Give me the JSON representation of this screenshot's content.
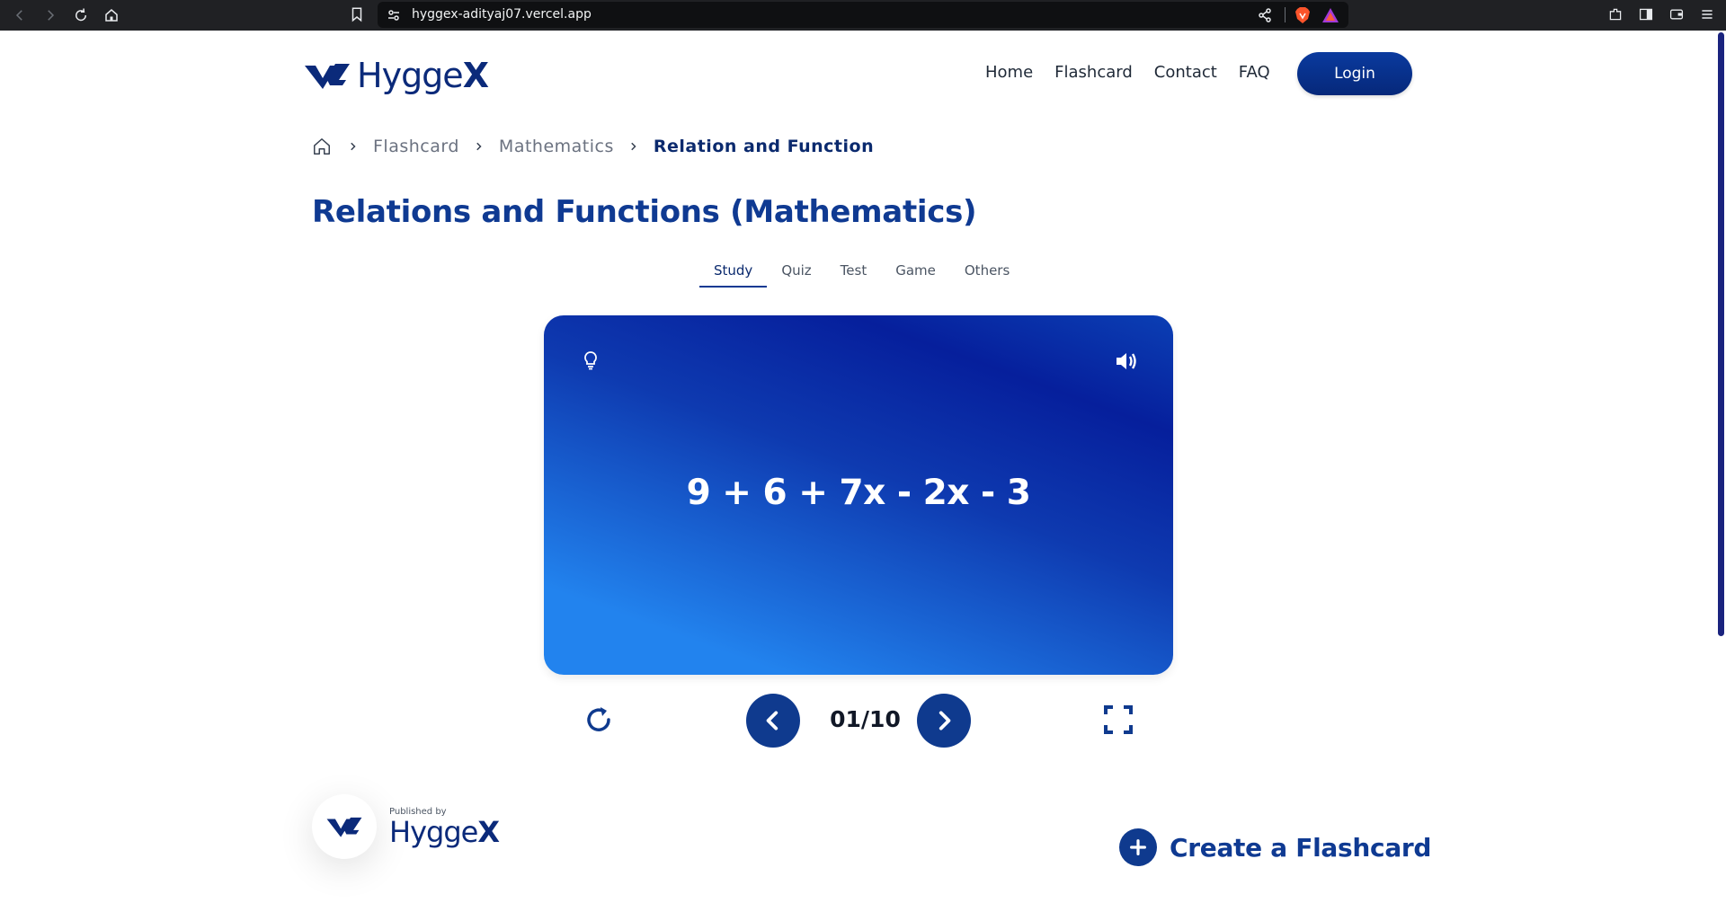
{
  "browser": {
    "url": "hyggex-adityaj07.vercel.app"
  },
  "header": {
    "logo_text_light": "Hygge",
    "logo_text_bold": "X",
    "nav": [
      "Home",
      "Flashcard",
      "Contact",
      "FAQ"
    ],
    "login_label": "Login"
  },
  "breadcrumb": {
    "items": [
      "Flashcard",
      "Mathematics",
      "Relation and Function"
    ]
  },
  "page_title": "Relations and Functions (Mathematics)",
  "tabs": {
    "items": [
      "Study",
      "Quiz",
      "Test",
      "Game",
      "Others"
    ],
    "active": "Study"
  },
  "card": {
    "question": "9 + 6 + 7x - 2x - 3"
  },
  "controls": {
    "counter": "01/10"
  },
  "publisher": {
    "label": "Published by",
    "brand_light": "Hygge",
    "brand_bold": "X"
  },
  "create": {
    "label": "Create a Flashcard"
  },
  "colors": {
    "brand_blue": "#0f3a92",
    "card_gradient_start": "#2283ee",
    "card_gradient_end": "#061f9c"
  }
}
